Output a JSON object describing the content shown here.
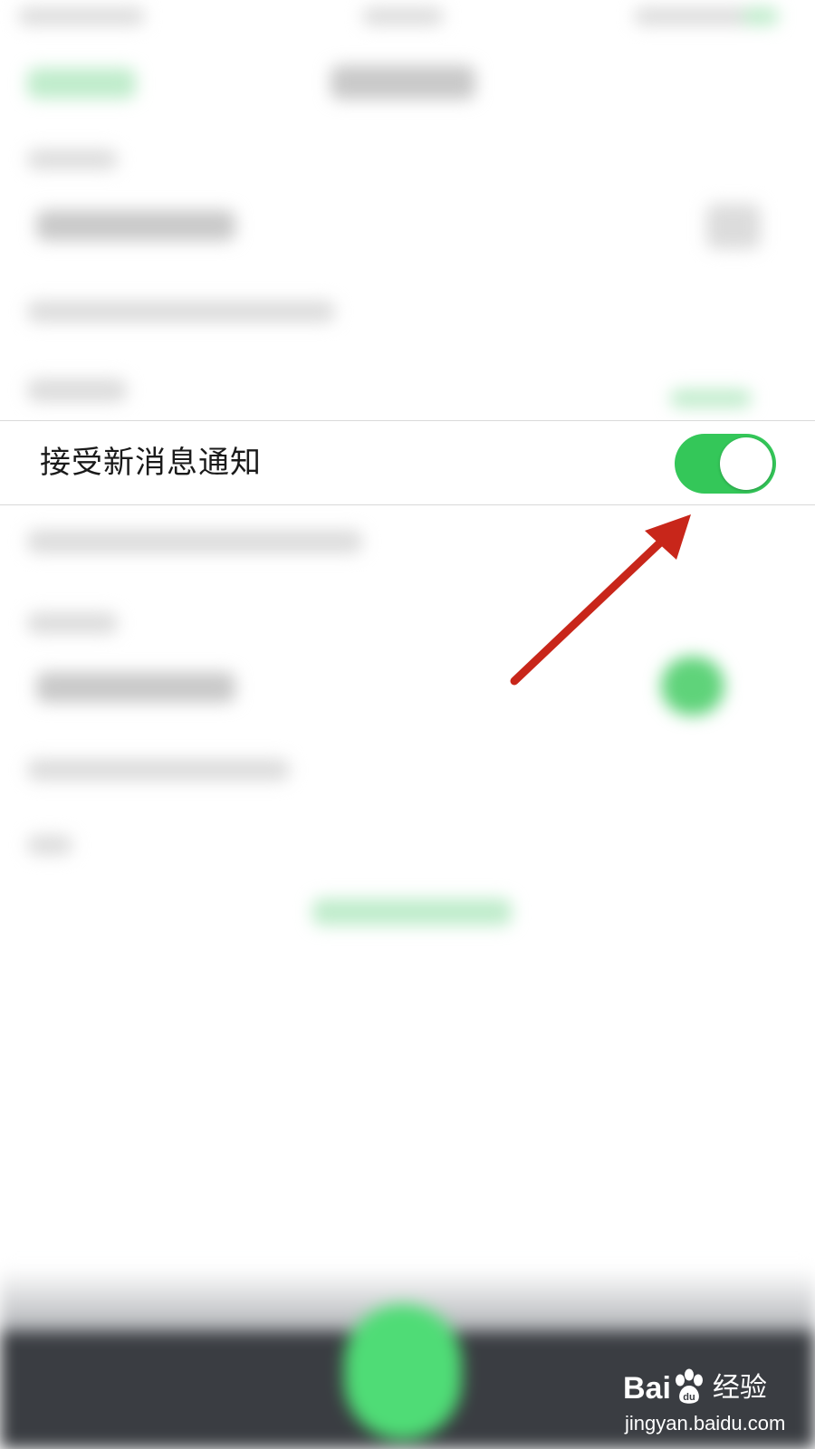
{
  "notification_setting": {
    "label": "接受新消息通知",
    "enabled": true,
    "toggle_color": "#34c759"
  },
  "annotation": {
    "type": "arrow",
    "color": "#c8261a",
    "points_to": "notification-toggle"
  },
  "watermark": {
    "brand_left": "Bai",
    "brand_right": "du",
    "brand_cn": "经验",
    "url": "jingyan.baidu.com",
    "logo_icon": "baidu-paw-icon"
  },
  "colors": {
    "background": "#ffffff",
    "divider": "#d9d9d9",
    "bottom_bar": "#3a3d42",
    "accent_green": "#34c759"
  }
}
